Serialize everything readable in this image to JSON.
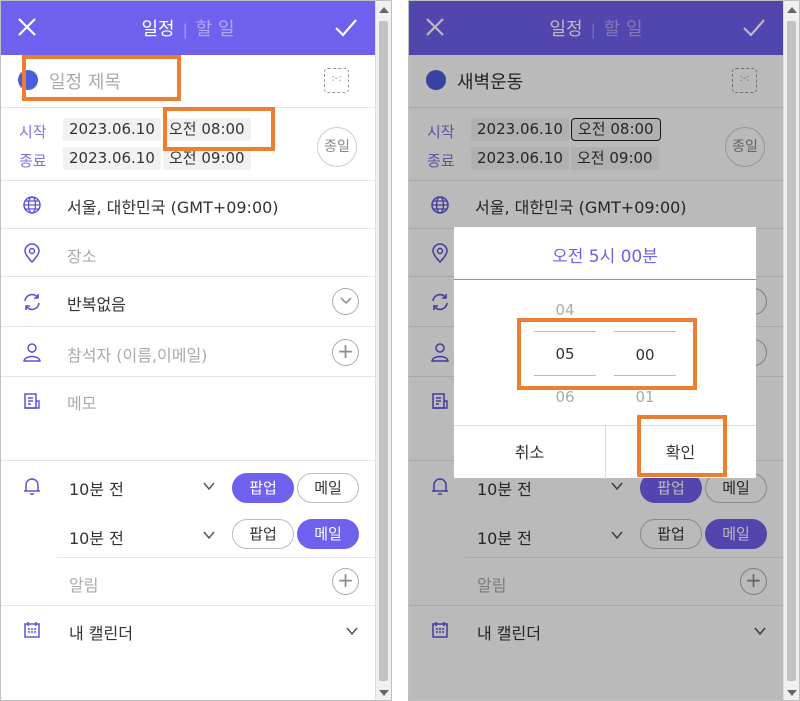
{
  "header": {
    "tab_schedule": "일정",
    "tab_todo": "할 일"
  },
  "left": {
    "title_placeholder": "일정 제목",
    "start_label": "시작",
    "end_label": "종료",
    "start_date": "2023.06.10",
    "start_time": "오전 08:00",
    "end_date": "2023.06.10",
    "end_time": "오전 09:00",
    "allday_label": "종일",
    "timezone": "서울, 대한민국 (GMT+09:00)",
    "location_placeholder": "장소",
    "repeat": "반복없음",
    "attendee_placeholder": "참석자 (이름,이메일)",
    "memo_placeholder": "메모",
    "alarm1_time": "10분 전",
    "alarm2_time": "10분 전",
    "popup_label": "팝업",
    "mail_label": "메일",
    "alarm_placeholder": "알림",
    "calendar": "내 캘린더",
    "add_symbol": "+"
  },
  "right": {
    "title": "새벽운동",
    "start_label": "시작",
    "end_label": "종료",
    "start_date": "2023.06.10",
    "start_time": "오전 08:00",
    "end_date": "2023.06.10",
    "end_time": "오전 09:00",
    "allday_label": "종일",
    "timezone": "서울, 대한민국 (GMT+09:00)",
    "alarm1_time": "10분 전",
    "alarm2_time": "10분 전",
    "popup_label": "팝업",
    "mail_label": "메일",
    "alarm_placeholder": "알림",
    "calendar": "내 캘린더",
    "add_symbol": "+",
    "dialog": {
      "title": "오전 5시 00분",
      "hour_prev": "04",
      "hour_selected": "05",
      "hour_next": "06",
      "minute_selected": "00",
      "minute_next": "01",
      "cancel_label": "취소",
      "confirm_label": "확인"
    }
  },
  "colors": {
    "accent": "#7060ee",
    "title_dot": "#4a5ddd",
    "highlight": "#ed7d31"
  }
}
